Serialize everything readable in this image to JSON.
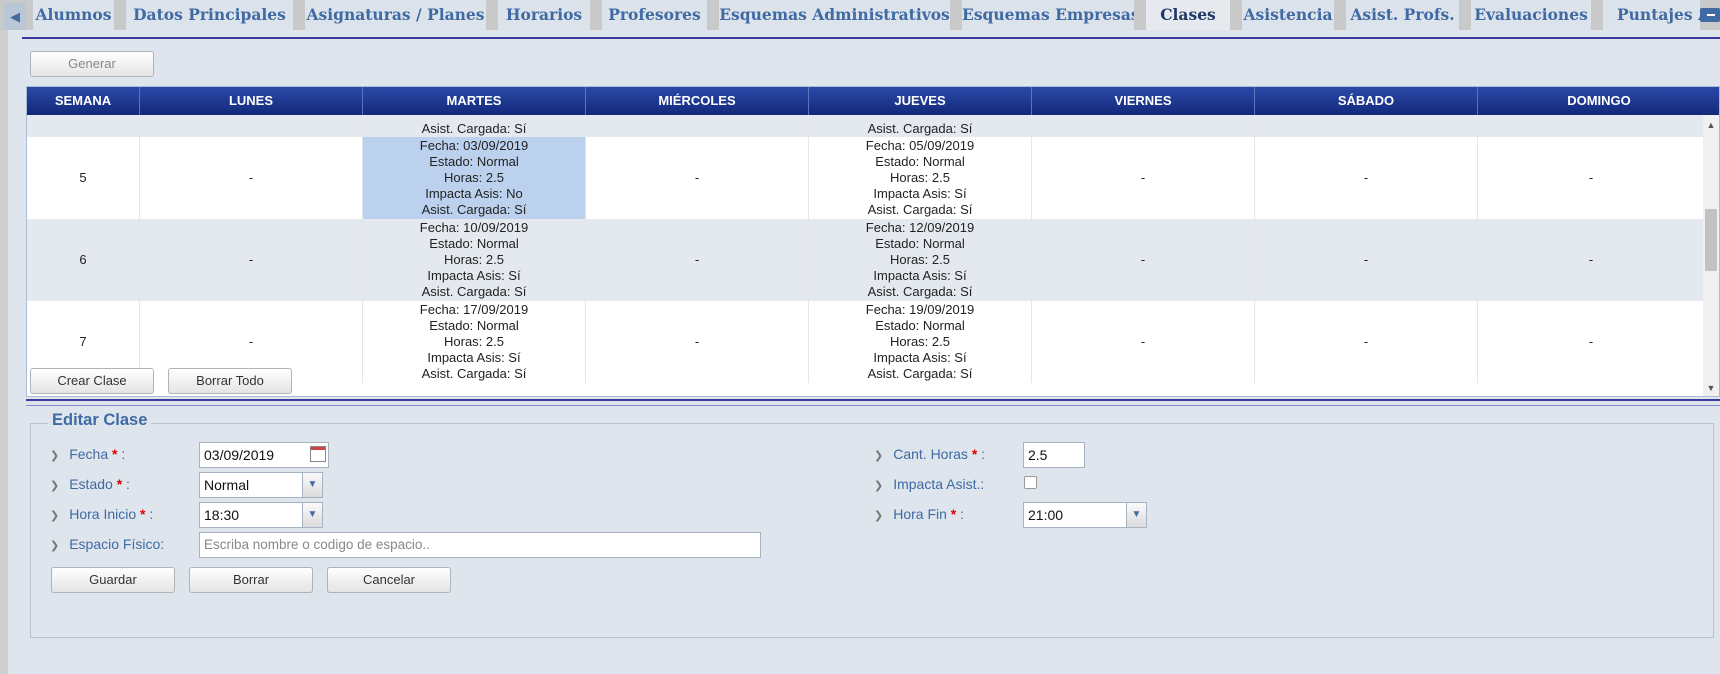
{
  "tabs": [
    {
      "label": "Alumnos"
    },
    {
      "label": "Datos Principales"
    },
    {
      "label": "Asignaturas / Planes"
    },
    {
      "label": "Horarios"
    },
    {
      "label": "Profesores"
    },
    {
      "label": "Esquemas Administrativos"
    },
    {
      "label": "Esquemas Empresas"
    },
    {
      "label": "Clases"
    },
    {
      "label": "Asistencia"
    },
    {
      "label": "Asist. Profs."
    },
    {
      "label": "Evaluaciones"
    },
    {
      "label": "Puntajes Al"
    }
  ],
  "toolbar": {
    "generate_label": "Generar"
  },
  "grid": {
    "headers": [
      "SEMANA",
      "LUNES",
      "MARTES",
      "MIÉRCOLES",
      "JUEVES",
      "VIERNES",
      "SÁBADO",
      "DOMINGO"
    ],
    "rows": [
      {
        "week": "",
        "cells": [
          "",
          [
            "Asist. Cargada: Sí"
          ],
          "",
          [
            "Asist. Cargada: Sí"
          ],
          "",
          "",
          ""
        ]
      },
      {
        "week": "5",
        "cells": [
          "-",
          [
            "Fecha: 03/09/2019",
            "Estado: Normal",
            "Horas: 2.5",
            "Impacta Asis: No",
            "Asist. Cargada: Sí"
          ],
          "-",
          [
            "Fecha: 05/09/2019",
            "Estado: Normal",
            "Horas: 2.5",
            "Impacta Asis: Sí",
            "Asist. Cargada: Sí"
          ],
          "-",
          "-",
          "-"
        ]
      },
      {
        "week": "6",
        "cells": [
          "-",
          [
            "Fecha: 10/09/2019",
            "Estado: Normal",
            "Horas: 2.5",
            "Impacta Asis: Sí",
            "Asist. Cargada: Sí"
          ],
          "-",
          [
            "Fecha: 12/09/2019",
            "Estado: Normal",
            "Horas: 2.5",
            "Impacta Asis: Sí",
            "Asist. Cargada: Sí"
          ],
          "-",
          "-",
          "-"
        ]
      },
      {
        "week": "7",
        "cells": [
          "-",
          [
            "Fecha: 17/09/2019",
            "Estado: Normal",
            "Horas: 2.5",
            "Impacta Asis: Sí",
            "Asist. Cargada: Sí"
          ],
          "-",
          [
            "Fecha: 19/09/2019",
            "Estado: Normal",
            "Horas: 2.5",
            "Impacta Asis: Sí",
            "Asist. Cargada: Sí"
          ],
          "-",
          "-",
          "-"
        ]
      }
    ]
  },
  "grid_actions": {
    "create_label": "Crear Clase",
    "delete_all_label": "Borrar Todo"
  },
  "edit": {
    "title": "Editar Clase",
    "fecha_label": "Fecha",
    "fecha_value": "03/09/2019",
    "estado_label": "Estado",
    "estado_value": "Normal",
    "hora_inicio_label": "Hora Inicio",
    "hora_inicio_value": "18:30",
    "espacio_label": "Espacio Físico:",
    "espacio_placeholder": "Escriba nombre o codigo de espacio..",
    "cant_horas_label": "Cant. Horas",
    "cant_horas_value": "2.5",
    "impacta_label": "Impacta Asist.:",
    "impacta_checked": false,
    "hora_fin_label": "Hora Fin",
    "hora_fin_value": "21:00",
    "required_mark": "*",
    "colon": ":",
    "save_label": "Guardar",
    "delete_label": "Borrar",
    "cancel_label": "Cancelar"
  },
  "icons": {
    "label_marker": "chevron-right-icon",
    "select_toggle": "chevron-down-icon",
    "calendar": "calendar-icon"
  },
  "colors": {
    "header_blue": "#1c348f",
    "selected_cell": "#bcd1ee",
    "label_blue": "#3f6aa3",
    "required_red": "#dd0000"
  }
}
